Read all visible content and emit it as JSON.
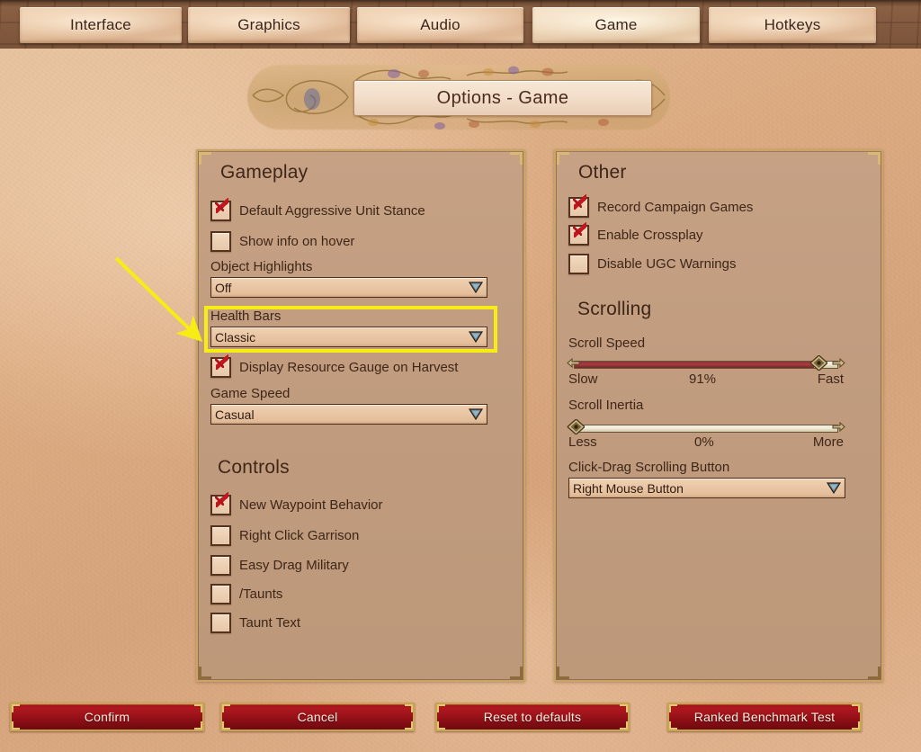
{
  "window": {
    "title": "Options - Game"
  },
  "tabs": [
    {
      "label": "Interface",
      "active": false
    },
    {
      "label": "Graphics",
      "active": false
    },
    {
      "label": "Audio",
      "active": false
    },
    {
      "label": "Game",
      "active": true
    },
    {
      "label": "Hotkeys",
      "active": false
    }
  ],
  "left_panel": {
    "gameplay": {
      "heading": "Gameplay",
      "checkboxes": [
        {
          "label": "Default Aggressive Unit Stance",
          "checked": true
        },
        {
          "label": "Show info on hover",
          "checked": false
        }
      ],
      "object_highlights": {
        "label": "Object Highlights",
        "value": "Off"
      },
      "health_bars": {
        "label": "Health Bars",
        "value": "Classic",
        "highlighted": true
      },
      "display_resource_gauge": {
        "label": "Display Resource Gauge on Harvest",
        "checked": true
      },
      "game_speed": {
        "label": "Game Speed",
        "value": "Casual"
      }
    },
    "controls": {
      "heading": "Controls",
      "checkboxes": [
        {
          "label": "New Waypoint Behavior",
          "checked": true
        },
        {
          "label": "Right Click Garrison",
          "checked": false
        },
        {
          "label": "Easy Drag Military",
          "checked": false
        },
        {
          "label": "/Taunts",
          "checked": false
        },
        {
          "label": "Taunt Text",
          "checked": false
        }
      ]
    }
  },
  "right_panel": {
    "other": {
      "heading": "Other",
      "checkboxes": [
        {
          "label": "Record Campaign Games",
          "checked": true
        },
        {
          "label": "Enable Crossplay",
          "checked": true
        },
        {
          "label": "Disable UGC Warnings",
          "checked": false
        }
      ]
    },
    "scrolling": {
      "heading": "Scrolling",
      "scroll_speed": {
        "label": "Scroll Speed",
        "min_label": "Slow",
        "max_label": "Fast",
        "value_label": "91%",
        "percent": 91
      },
      "scroll_inertia": {
        "label": "Scroll Inertia",
        "min_label": "Less",
        "max_label": "More",
        "value_label": "0%",
        "percent": 0
      },
      "click_drag_button": {
        "label": "Click-Drag Scrolling Button",
        "value": "Right Mouse Button"
      }
    }
  },
  "footer": {
    "buttons": [
      {
        "label": "Confirm"
      },
      {
        "label": "Cancel"
      },
      {
        "label": "Reset to defaults"
      },
      {
        "label": "Ranked Benchmark Test"
      }
    ]
  },
  "annotation": {
    "arrow_color": "#f7ec16",
    "highlight_color": "#f7ec16",
    "target": "Health Bars"
  },
  "colors": {
    "parchment": "#dcab81",
    "panel_fill": "#c09b7e",
    "panel_border": "#caa464",
    "text": "#3e2618",
    "button_red": "#9c1219",
    "button_gold": "#c9a450",
    "slider_fill": "#a83c3f",
    "check_red": "#c0181e"
  }
}
